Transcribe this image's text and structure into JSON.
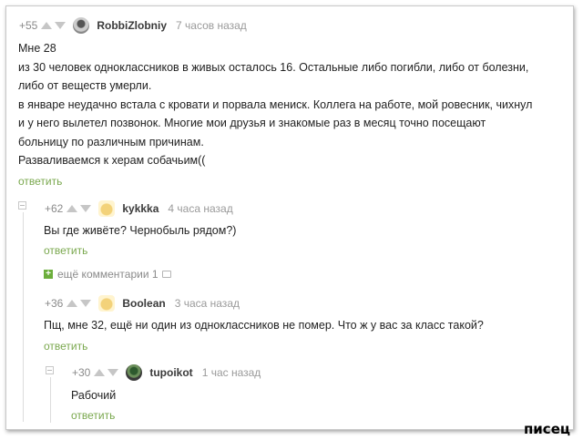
{
  "comments": [
    {
      "rating": "+55",
      "username": "RobbiZlobniy",
      "time": "7 часов назад",
      "lines": [
        "Мне 28",
        "из 30 человек одноклассников в живых осталось 16. Остальные либо погибли, либо от болезни,",
        "либо от веществ умерли.",
        "в январе неудачно встала с кровати и порвала мениск. Коллега на работе, мой ровесник, чихнул",
        "и у него вылетел позвонок. Многие мои друзья и знакомые раз в месяц точно посещают",
        "больницу по различным причинам.",
        "Разваливаемся к херам собачьим(("
      ],
      "reply": "ответить"
    },
    {
      "rating": "+62",
      "username": "kykkka",
      "time": "4 часа назад",
      "lines": [
        "Вы где живёте? Чернобыль рядом?)"
      ],
      "reply": "ответить",
      "more_comments": "ещё комментарии 1"
    },
    {
      "rating": "+36",
      "username": "Boolean",
      "time": "3 часа назад",
      "lines": [
        "Пщ, мне 32, ещё ни один из одноклассников не помер. Что ж у вас за класс такой?"
      ],
      "reply": "ответить"
    },
    {
      "rating": "+30",
      "username": "tupoikot",
      "time": "1 час назад",
      "lines": [
        "Рабочий"
      ],
      "reply": "ответить"
    }
  ],
  "watermark": "писец"
}
